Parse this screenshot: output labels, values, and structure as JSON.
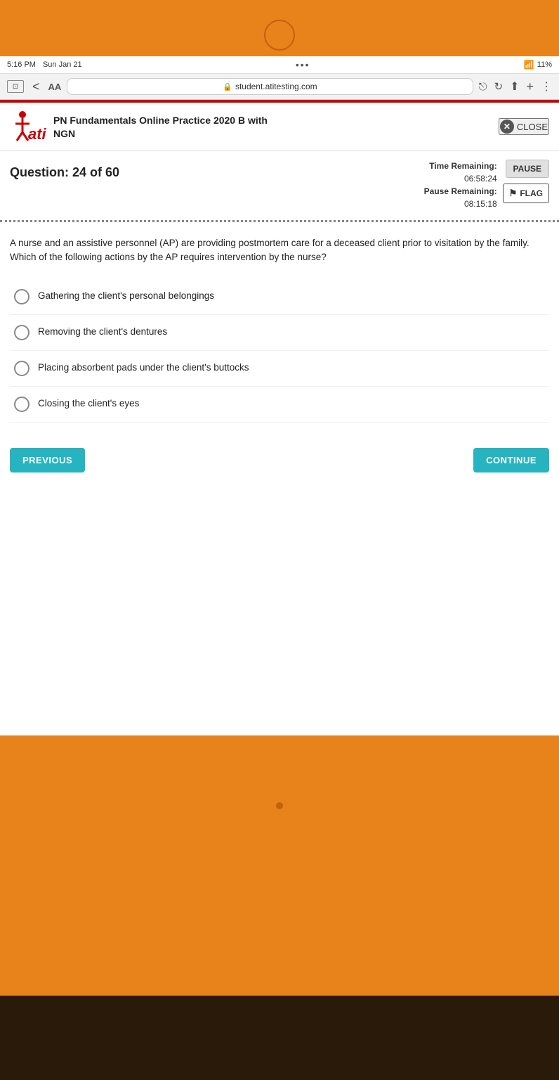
{
  "device": {
    "status_bar": {
      "time": "5:16 PM",
      "date": "Sun Jan 21",
      "wifi_icon": "📶",
      "battery": "11%"
    },
    "browser": {
      "url": "student.atitesting.com",
      "aa_label": "AA"
    }
  },
  "header": {
    "title_line1": "PN Fundamentals Online Practice 2020 B with",
    "title_line2": "NGN",
    "close_label": "CLOSE"
  },
  "question": {
    "number_label": "Question: 24 of 60",
    "timer": {
      "remaining_label": "Time Remaining:",
      "remaining_value": "06:58:24",
      "pause_label": "Pause Remaining:",
      "pause_value": "08:15:18"
    },
    "pause_button": "PAUSE",
    "flag_button": "FLAG",
    "text": "A nurse and an assistive personnel (AP) are providing postmortem care for a deceased client prior to visitation by the family. Which of the following actions by the AP requires intervention by the nurse?"
  },
  "options": [
    {
      "id": "A",
      "text": "Gathering the client's personal belongings"
    },
    {
      "id": "B",
      "text": "Removing the client's dentures"
    },
    {
      "id": "C",
      "text": "Placing absorbent pads under the client's buttocks"
    },
    {
      "id": "D",
      "text": "Closing the client's eyes"
    }
  ],
  "navigation": {
    "previous_label": "PREVIOUS",
    "continue_label": "CONTINUE"
  }
}
